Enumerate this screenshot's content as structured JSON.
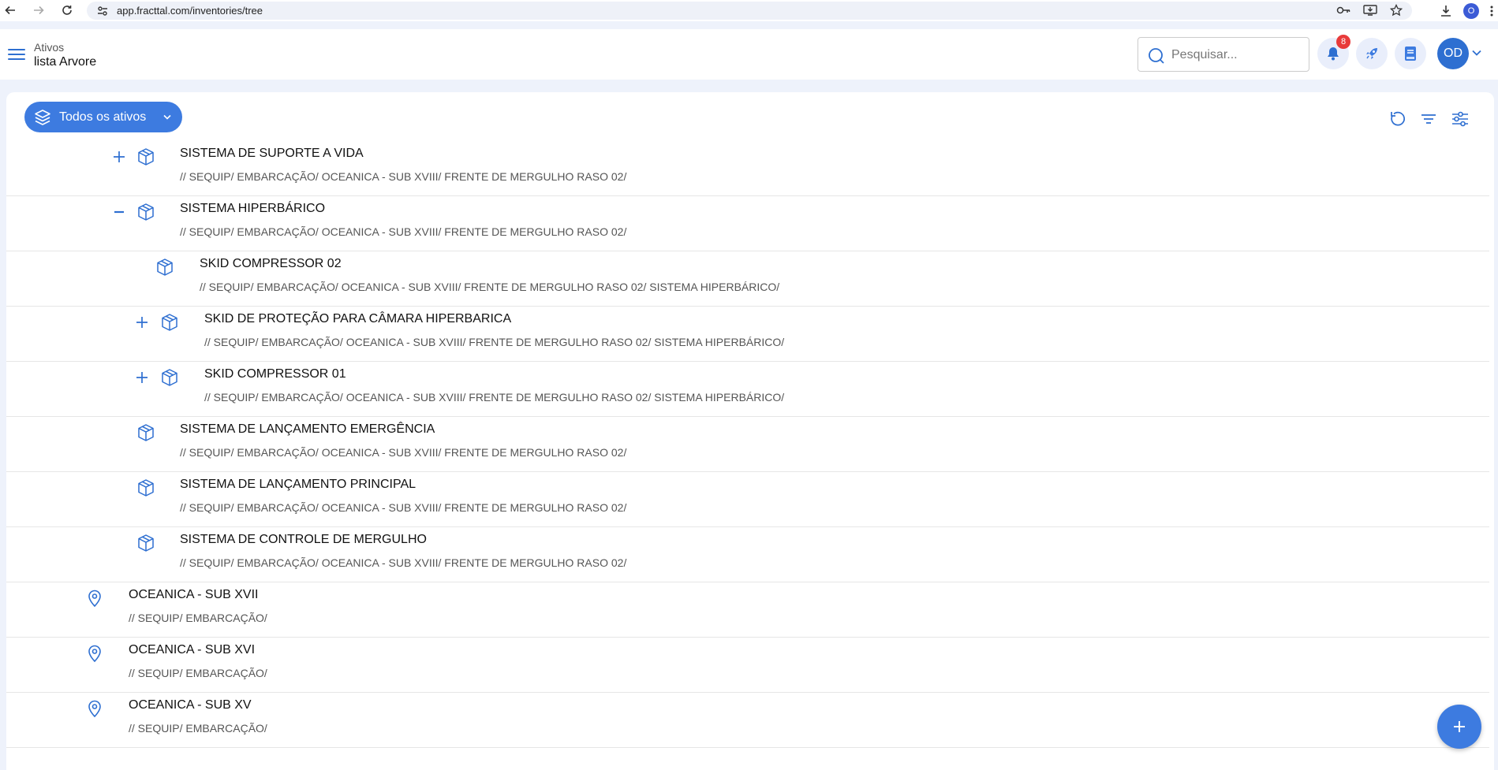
{
  "browser": {
    "url": "app.fracttal.com/inventories/tree",
    "profile_initial": "O"
  },
  "header": {
    "breadcrumb": "Ativos",
    "title": "lista Arvore",
    "search_placeholder": "Pesquisar...",
    "notifications_count": "8",
    "avatar_initials": "OD"
  },
  "toolbar": {
    "scope_label": "Todos os ativos"
  },
  "colors": {
    "accent": "#3d7be0",
    "badge": "#e83a3a"
  },
  "tree": [
    {
      "name": "SISTEMA DE SUPORTE A VIDA",
      "path": "// SEQUIP/ EMBARCAÇÃO/ OCEANICA - SUB XVIII/ FRENTE DE MERGULHO RASO 02/",
      "icon": "box-icon",
      "expander": "plus",
      "level": 3
    },
    {
      "name": "SISTEMA HIPERBÁRICO",
      "path": "// SEQUIP/ EMBARCAÇÃO/ OCEANICA - SUB XVIII/ FRENTE DE MERGULHO RASO 02/",
      "icon": "box-icon",
      "expander": "minus",
      "level": 3
    },
    {
      "name": "SKID COMPRESSOR 02",
      "path": "// SEQUIP/ EMBARCAÇÃO/ OCEANICA - SUB XVIII/ FRENTE DE MERGULHO RASO 02/ SISTEMA HIPERBÁRICO/",
      "icon": "box-icon",
      "expander": "none",
      "level": 4
    },
    {
      "name": "SKID DE PROTEÇÃO PARA CÂMARA HIPERBARICA",
      "path": "// SEQUIP/ EMBARCAÇÃO/ OCEANICA - SUB XVIII/ FRENTE DE MERGULHO RASO 02/ SISTEMA HIPERBÁRICO/",
      "icon": "box-icon",
      "expander": "plus",
      "level": 4
    },
    {
      "name": "SKID COMPRESSOR 01",
      "path": "// SEQUIP/ EMBARCAÇÃO/ OCEANICA - SUB XVIII/ FRENTE DE MERGULHO RASO 02/ SISTEMA HIPERBÁRICO/",
      "icon": "box-icon",
      "expander": "plus",
      "level": 4
    },
    {
      "name": "SISTEMA DE LANÇAMENTO EMERGÊNCIA",
      "path": "// SEQUIP/ EMBARCAÇÃO/ OCEANICA - SUB XVIII/ FRENTE DE MERGULHO RASO 02/",
      "icon": "box-icon",
      "expander": "none",
      "level": 3
    },
    {
      "name": "SISTEMA DE LANÇAMENTO PRINCIPAL",
      "path": "// SEQUIP/ EMBARCAÇÃO/ OCEANICA - SUB XVIII/ FRENTE DE MERGULHO RASO 02/",
      "icon": "box-icon",
      "expander": "none",
      "level": 3
    },
    {
      "name": "SISTEMA DE CONTROLE DE MERGULHO",
      "path": "// SEQUIP/ EMBARCAÇÃO/ OCEANICA - SUB XVIII/ FRENTE DE MERGULHO RASO 02/",
      "icon": "box-icon",
      "expander": "none",
      "level": 3
    },
    {
      "name": "OCEANICA - SUB XVII",
      "path": "// SEQUIP/ EMBARCAÇÃO/",
      "icon": "location-icon",
      "expander": "none",
      "level": 2
    },
    {
      "name": "OCEANICA - SUB XVI",
      "path": "// SEQUIP/ EMBARCAÇÃO/",
      "icon": "location-icon",
      "expander": "none",
      "level": 2
    },
    {
      "name": "OCEANICA - SUB XV",
      "path": "// SEQUIP/ EMBARCAÇÃO/",
      "icon": "location-icon",
      "expander": "none",
      "level": 2
    }
  ]
}
